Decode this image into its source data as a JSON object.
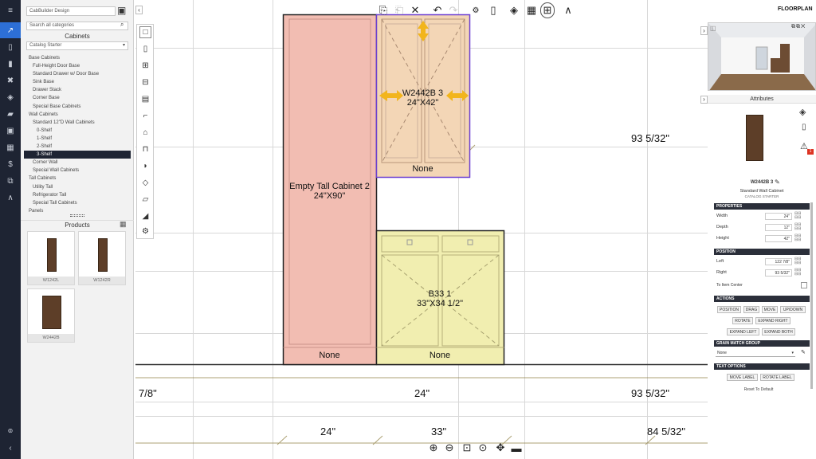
{
  "sidebar": {
    "project_name": "CabBuilder Design",
    "search_placeholder": "Search all categories",
    "cabinets_heading": "Cabinets",
    "catalog_selected": "Catalog Starter",
    "tree": [
      {
        "label": "Base Cabinets",
        "level": 0,
        "selected": false
      },
      {
        "label": "Full-Height Door Base",
        "level": 1,
        "selected": false
      },
      {
        "label": "Standard Drawer w/ Door Base",
        "level": 1,
        "selected": false
      },
      {
        "label": "Sink Base",
        "level": 1,
        "selected": false
      },
      {
        "label": "Drawer Stack",
        "level": 1,
        "selected": false
      },
      {
        "label": "Corner Base",
        "level": 1,
        "selected": false
      },
      {
        "label": "Special Base Cabinets",
        "level": 1,
        "selected": false
      },
      {
        "label": "Wall Cabinets",
        "level": 0,
        "selected": false
      },
      {
        "label": "Standard 12\"D Wall Cabinets",
        "level": 1,
        "selected": false
      },
      {
        "label": "0-Shelf",
        "level": 2,
        "selected": false
      },
      {
        "label": "1-Shelf",
        "level": 2,
        "selected": false
      },
      {
        "label": "2-Shelf",
        "level": 2,
        "selected": false
      },
      {
        "label": "3-Shelf",
        "level": 2,
        "selected": true
      },
      {
        "label": "Corner Wall",
        "level": 1,
        "selected": false
      },
      {
        "label": "Special Wall Cabinets",
        "level": 1,
        "selected": false
      },
      {
        "label": "Tall Cabinets",
        "level": 0,
        "selected": false
      },
      {
        "label": "Utility Tall",
        "level": 1,
        "selected": false
      },
      {
        "label": "Refrigerator Tall",
        "level": 1,
        "selected": false
      },
      {
        "label": "Special Tall Cabinets",
        "level": 1,
        "selected": false
      },
      {
        "label": "Panels",
        "level": 0,
        "selected": false
      }
    ],
    "products_heading": "Products",
    "products": [
      "W1242L",
      "W1242R",
      "W2442B"
    ]
  },
  "view_mode": "FLOORPLAN",
  "canvas": {
    "tall_cabinet": {
      "name": "Empty Tall Cabinet 2",
      "size": "24\"X90\"",
      "footer": "None"
    },
    "wall_cabinet": {
      "name": "W2442B 3",
      "size": "24\"X42\"",
      "footer": "None"
    },
    "base_cabinet": {
      "name": "B33 1",
      "size": "33\"X34 1/2\"",
      "footer": "None"
    },
    "dimensions": {
      "right_upper": "93 5/32\"",
      "left_row1": "7/8\"",
      "mid_row1": "24\"",
      "right_row1": "93 5/32\"",
      "left_row2": "24\"",
      "mid_row2": "33\"",
      "right_row2": "84 5/32\""
    }
  },
  "attributes": {
    "heading": "Attributes",
    "item_name": "W2442B 3",
    "item_desc": "Standard Wall Cabinet",
    "item_catalog": "CATALOG STARTER",
    "properties_heading": "PROPERTIES",
    "width_label": "Width",
    "width_value": "24\"",
    "depth_label": "Depth",
    "depth_value": "12\"",
    "height_label": "Height",
    "height_value": "42\"",
    "position_heading": "POSITION",
    "left_label": "Left",
    "left_value": "122 7/8\"",
    "right_label": "Right",
    "right_value": "93 5/32\"",
    "to_center_label": "To Item Center",
    "actions_heading": "ACTIONS",
    "actions": [
      "POSITION",
      "DRAG",
      "MOVE",
      "UP/DOWN",
      "ROTATE",
      "EXPAND RIGHT",
      "EXPAND LEFT",
      "EXPAND BOTH"
    ],
    "grain_heading": "GRAIN MATCH GROUP",
    "grain_value": "None",
    "text_heading": "TEXT OPTIONS",
    "text_actions": [
      "MOVE LABEL",
      "ROTATE LABEL"
    ],
    "reset_label": "Reset To Default",
    "warning_count": "1"
  }
}
